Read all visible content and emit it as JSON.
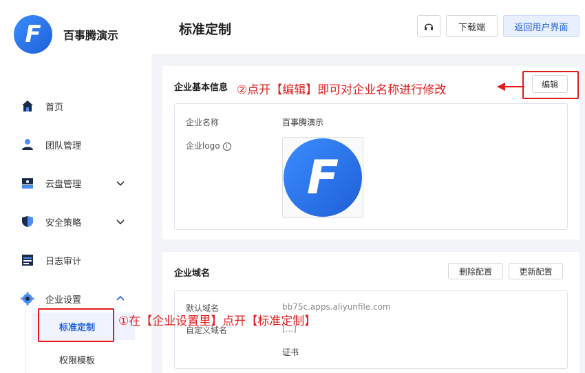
{
  "brand": {
    "logo_letter": "F",
    "name": "百事腾演示"
  },
  "header": {
    "title": "标准定制",
    "headset_icon": "headset-icon",
    "download_label": "下载端",
    "return_label": "返回用户界面"
  },
  "sidebar": {
    "items": [
      {
        "label": "首页",
        "icon": "home-icon"
      },
      {
        "label": "团队管理",
        "icon": "user-icon"
      },
      {
        "label": "云盘管理",
        "icon": "cloud-drive-icon"
      },
      {
        "label": "安全策略",
        "icon": "shield-icon"
      },
      {
        "label": "日志审计",
        "icon": "log-icon"
      },
      {
        "label": "企业设置",
        "icon": "gear-icon"
      }
    ],
    "sub_items": [
      {
        "label": "标准定制",
        "active": true
      },
      {
        "label": "权限模板",
        "active": false
      }
    ]
  },
  "basic_info": {
    "title": "企业基本信息",
    "edit_label": "编辑",
    "name_label": "企业名称",
    "name_value": "百事腾演示",
    "logo_label": "企业logo",
    "info_glyph": "i"
  },
  "domain": {
    "title": "企业域名",
    "delete_label": "删除配置",
    "update_label": "更新配置",
    "default_label": "默认域名",
    "default_value": "bb75c.apps.aliyunfile.com",
    "custom_label": "自定义域名",
    "custom_value": "[...]",
    "cert_label": "证书"
  },
  "annotations": {
    "edit_hint": "②点开【编辑】即可对企业名称进行修改",
    "settings_hint": "①在【企业设置里】点开【标准定制】"
  },
  "colors": {
    "accent": "#1f5fd6",
    "annotation": "#e21b1b"
  }
}
